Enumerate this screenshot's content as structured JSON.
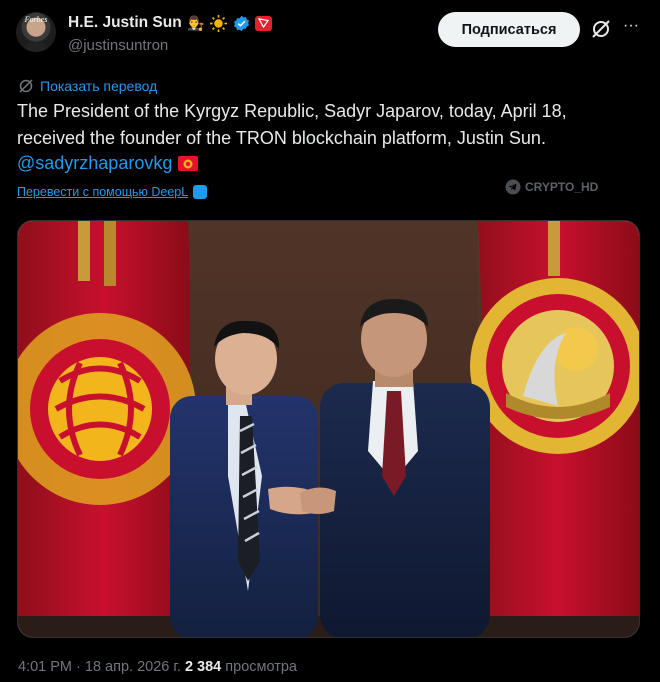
{
  "author": {
    "display_name": "H.E. Justin Sun",
    "handle": "@justinsuntron",
    "avatar_text": "Forbes"
  },
  "header": {
    "subscribe_label": "Подписаться",
    "more_label": "···"
  },
  "tweet": {
    "show_translation": "Показать перевод",
    "text": "The President of the Kyrgyz Republic, Sadyr Japarov, today, April 18, received the founder of the TRON blockchain platform, Justin Sun.",
    "mention": "@sadyrzhaparovkg",
    "translate_link": "Перевести с помощью DeepL",
    "watermark": "CRYPTO_HD"
  },
  "meta": {
    "time": "4:01 PM",
    "separator": " · ",
    "date": "18 апр. 2026 г.",
    "views_count": "2 384",
    "views_label": "просмотра"
  },
  "colors": {
    "accent": "#1d9bf0",
    "background": "#000000",
    "text": "#e7e9ea",
    "muted": "#71767b",
    "flag_red": "#c8102e",
    "sun_yellow": "#f2b51b"
  },
  "icons": [
    "verified-badge-icon",
    "sun-emoji-icon",
    "judge-emoji-icon",
    "tron-icon",
    "grok-icon",
    "more-icon",
    "translate-icon",
    "deepl-icon",
    "telegram-icon",
    "kyrgyz-flag-icon"
  ]
}
